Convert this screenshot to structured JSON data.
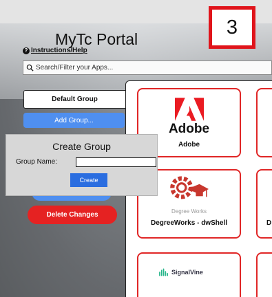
{
  "portal": {
    "title": "MyTc Portal",
    "help_link": "Instructions/Help",
    "help_icon": "question-circle-icon"
  },
  "step_marker": "3",
  "search": {
    "placeholder": "Search/Filter your Apps..."
  },
  "groups": {
    "active_tab": "Default Group",
    "add_group_label": "Add Group...",
    "delete_changes_label": "Delete Changes"
  },
  "create_group_dialog": {
    "title": "Create Group",
    "name_label": "Group Name:",
    "name_value": "",
    "create_button": "Create"
  },
  "apps": [
    {
      "name": "Adobe",
      "logo_text": "Adobe"
    },
    {
      "name": "DegreeWorks - dwShell",
      "logo_text": "Degree Works"
    },
    {
      "name": "",
      "logo_text": "SignalVine"
    },
    {
      "name": "D",
      "logo_text": ""
    }
  ],
  "colors": {
    "accent_blue": "#4f8ff0",
    "danger_red": "#e52222",
    "card_border": "#e02626",
    "adobe_red": "#ea1b22",
    "degree_works_red": "#c8372e",
    "signalvine_green": "#27b58a"
  }
}
